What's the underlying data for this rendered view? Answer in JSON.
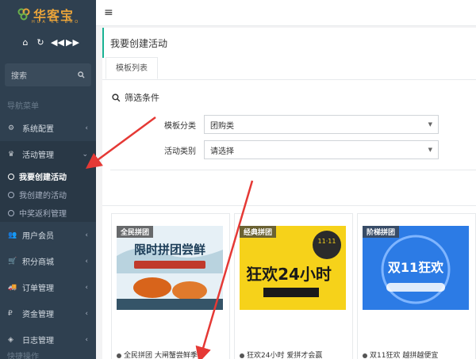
{
  "app": {
    "logo_text": "华客宝",
    "logo_sub": "HUA KE BAO"
  },
  "toolbar": {
    "icons": [
      "home-icon",
      "refresh-icon",
      "rewind-icon",
      "forward-icon"
    ]
  },
  "sidebar": {
    "search_label": "搜索",
    "nav_header": "导航菜单",
    "items": [
      {
        "label": "系统配置",
        "icon": "gear-icon"
      },
      {
        "label": "活动管理",
        "icon": "trophy-icon"
      },
      {
        "label": "用户会员",
        "icon": "users-icon"
      },
      {
        "label": "积分商城",
        "icon": "cart-icon"
      },
      {
        "label": "订单管理",
        "icon": "truck-icon"
      },
      {
        "label": "资金管理",
        "icon": "money-icon"
      },
      {
        "label": "日志管理",
        "icon": "shield-icon"
      }
    ],
    "subitems": [
      {
        "label": "我要创建活动"
      },
      {
        "label": "我创建的活动"
      },
      {
        "label": "中奖返利管理"
      }
    ],
    "bottom_label": "快捷操作"
  },
  "topbar": {
    "menu_icon": "≡"
  },
  "page": {
    "title": "我要创建活动",
    "tab": "模板列表",
    "filter_title": "筛选条件",
    "filters": [
      {
        "label": "模板分类",
        "value": "团购类"
      },
      {
        "label": "活动类别",
        "value": "请选择"
      }
    ]
  },
  "cards": [
    {
      "tag": "全民拼团",
      "title": "全民拼团 大闸蟹尝鲜季",
      "thumb_text": "限时拼团尝鲜"
    },
    {
      "tag": "经典拼团",
      "title": "狂欢24小时 爱拼才会赢",
      "thumb_text": "狂欢24小时"
    },
    {
      "tag": "阶梯拼团",
      "title": "双11狂欢 越拼越便宜",
      "thumb_text": "双11狂欢"
    }
  ],
  "colors": {
    "sidebar_bg": "#2f4050",
    "accent": "#1ab394",
    "arrow": "#e53935",
    "logo": "#e8a33a"
  }
}
